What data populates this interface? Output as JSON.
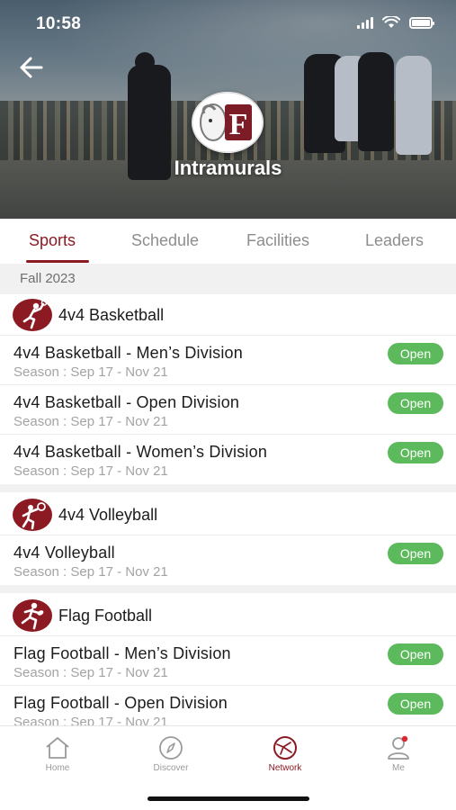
{
  "status_bar": {
    "time": "10:58"
  },
  "hero": {
    "title": "Intramurals",
    "logo_letter": "F"
  },
  "tabs": [
    {
      "label": "Sports",
      "active": true
    },
    {
      "label": "Schedule",
      "active": false
    },
    {
      "label": "Facilities",
      "active": false
    },
    {
      "label": "Leaders",
      "active": false
    }
  ],
  "season_label": "Fall 2023",
  "sections": [
    {
      "name": "4v4 Basketball",
      "icon": "basketball-icon",
      "leagues": [
        {
          "title": "4v4 Basketball - Men’s Division",
          "season": "Season : Sep 17 - Nov 21",
          "status": "Open"
        },
        {
          "title": "4v4 Basketball - Open Division",
          "season": "Season : Sep 17 - Nov 21",
          "status": "Open"
        },
        {
          "title": "4v4 Basketball - Women’s Division",
          "season": "Season : Sep 17 - Nov 21",
          "status": "Open"
        }
      ]
    },
    {
      "name": "4v4 Volleyball",
      "icon": "volleyball-icon",
      "leagues": [
        {
          "title": "4v4 Volleyball",
          "season": "Season : Sep 17 - Nov 21",
          "status": "Open"
        }
      ]
    },
    {
      "name": "Flag Football",
      "icon": "football-icon",
      "leagues": [
        {
          "title": "Flag Football - Men’s Division",
          "season": "Season : Sep 17 - Nov 21",
          "status": "Open"
        },
        {
          "title": "Flag Football - Open Division",
          "season": "Season : Sep 17 - Nov 21",
          "status": "Open"
        }
      ]
    }
  ],
  "bottom_nav": [
    {
      "label": "Home",
      "icon": "home-icon",
      "active": false
    },
    {
      "label": "Discover",
      "icon": "compass-icon",
      "active": false
    },
    {
      "label": "Network",
      "icon": "network-icon",
      "active": true
    },
    {
      "label": "Me",
      "icon": "person-icon",
      "active": false,
      "badge": true
    }
  ],
  "colors": {
    "accent": "#8c1a22",
    "open_status": "#5cba5c",
    "muted_text": "#a3a3a3"
  }
}
